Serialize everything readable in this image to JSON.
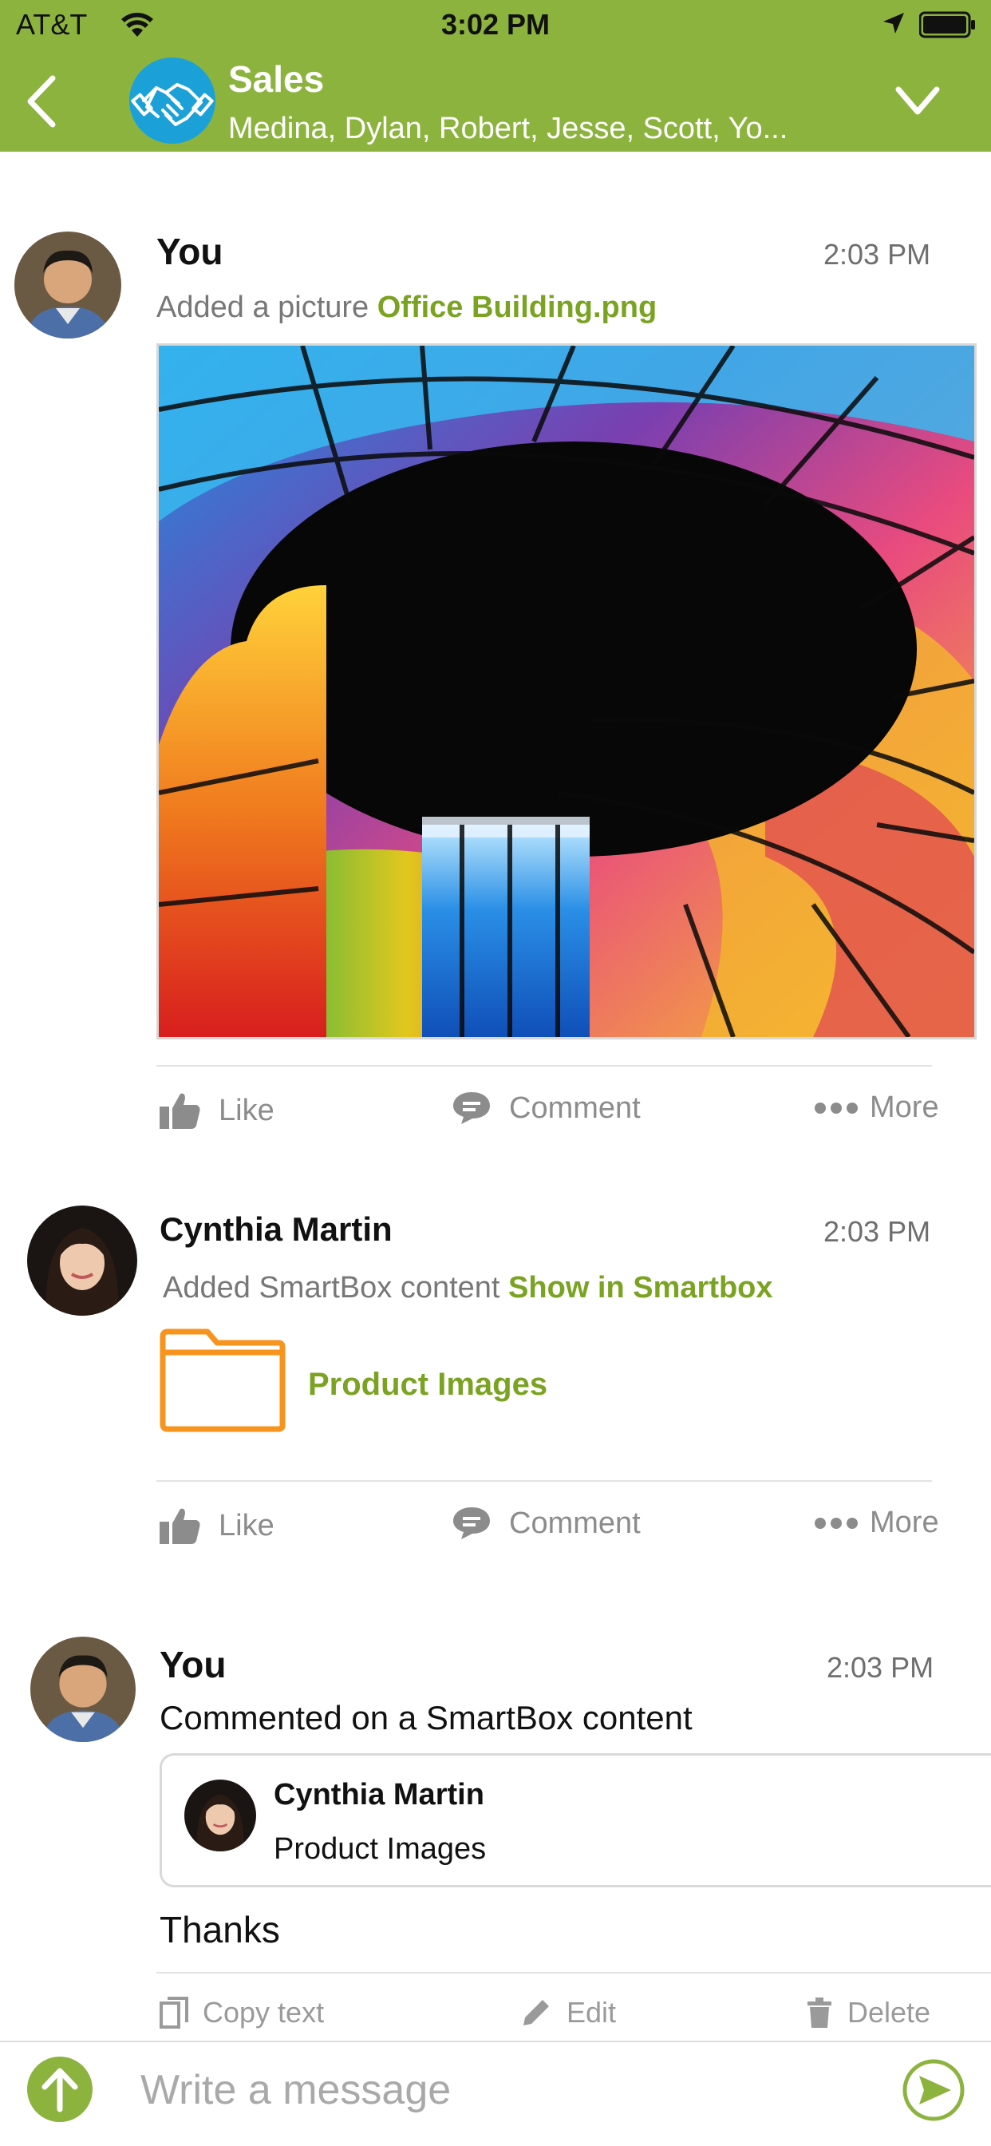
{
  "status": {
    "carrier": "AT&T",
    "time": "3:02 PM"
  },
  "header": {
    "title": "Sales",
    "members": "Medina, Dylan, Robert, Jesse, Scott, Yo..."
  },
  "posts": [
    {
      "author": "You",
      "time": "2:03 PM",
      "action_prefix": "Added a picture",
      "action_link": "Office Building.png"
    },
    {
      "author": "Cynthia Martin",
      "time": "2:03 PM",
      "action_prefix": "Added SmartBox content",
      "action_link": "Show in Smartbox",
      "folder_label": "Product Images"
    },
    {
      "author": "You",
      "time": "2:03 PM",
      "summary": "Commented on a SmartBox content",
      "quote_author": "Cynthia Martin",
      "quote_item": "Product Images",
      "comment": "Thanks"
    }
  ],
  "actions": {
    "like": "Like",
    "comment": "Comment",
    "more": "More",
    "copy": "Copy text",
    "edit": "Edit",
    "delete": "Delete"
  },
  "composer": {
    "placeholder": "Write a message"
  },
  "colors": {
    "header_bg": "#8db33f",
    "accent_green": "#7aa322",
    "folder_orange": "#f7941d",
    "group_avatar_blue": "#1ba1d8"
  }
}
